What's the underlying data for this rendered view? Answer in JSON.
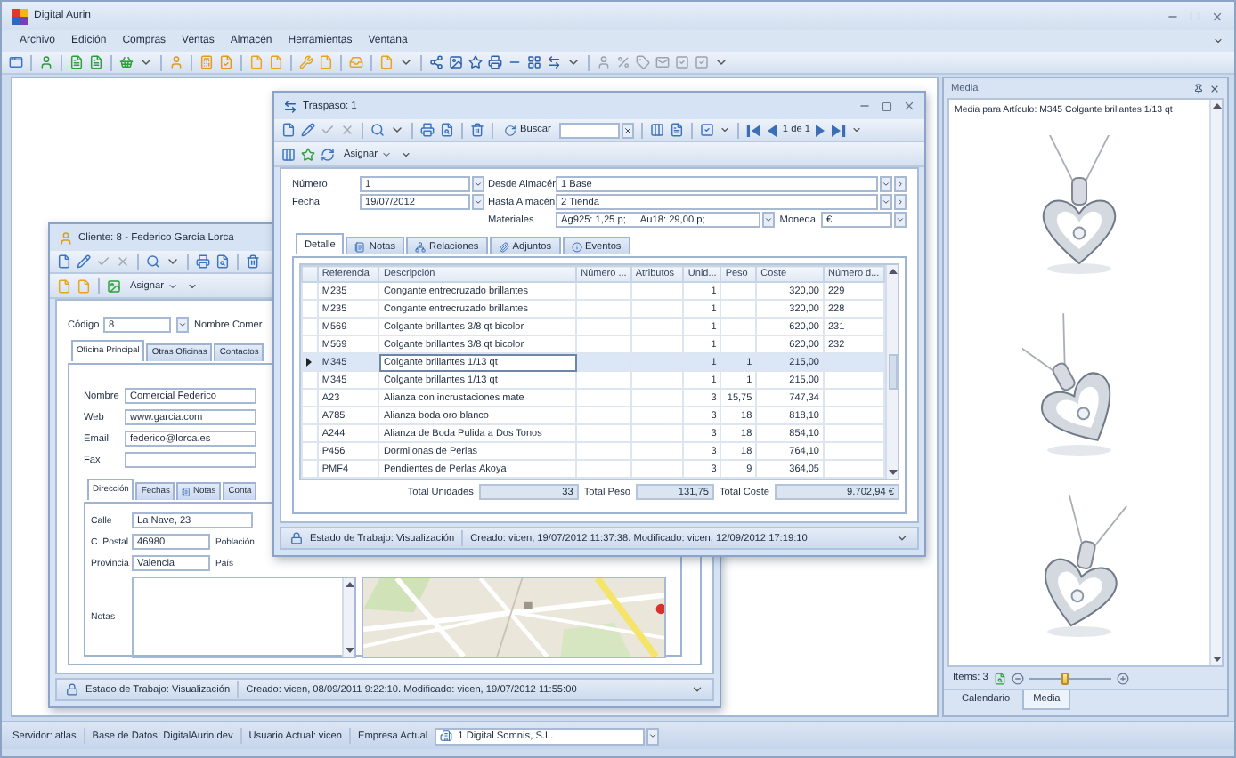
{
  "app": {
    "title": "Digital Aurin"
  },
  "menu": [
    "Archivo",
    "Edición",
    "Compras",
    "Ventas",
    "Almacén",
    "Herramientas",
    "Ventana"
  ],
  "traspaso": {
    "title": "Traspaso: 1",
    "search_label": "Buscar",
    "pager": "1 de 1",
    "assign": "Asignar",
    "numero": {
      "label": "Número",
      "value": "1"
    },
    "fecha": {
      "label": "Fecha",
      "value": "19/07/2012"
    },
    "desde": {
      "label": "Desde Almacén",
      "value": "1 Base"
    },
    "hasta": {
      "label": "Hasta Almacén",
      "value": "2 Tienda"
    },
    "materiales": {
      "label": "Materiales",
      "values": [
        "Ag925: 1,25 p;",
        "Au18: 29,00 p;"
      ]
    },
    "moneda": {
      "label": "Moneda",
      "value": "€"
    },
    "tabs": [
      {
        "label": "Detalle",
        "selected": true
      },
      {
        "label": "Notas",
        "selected": false
      },
      {
        "label": "Relaciones",
        "selected": false
      },
      {
        "label": "Adjuntos",
        "selected": false
      },
      {
        "label": "Eventos",
        "selected": false
      }
    ],
    "grid": {
      "columns": [
        "Referencia",
        "Descripción",
        "Número ...",
        "Atributos",
        "Unid...",
        "Peso",
        "Coste",
        "Número d..."
      ],
      "rows": [
        {
          "ref": "M235",
          "desc": "Congante entrecruzado brillantes",
          "units": "1",
          "cost": "320,00",
          "serial": "229",
          "selected": false
        },
        {
          "ref": "M235",
          "desc": "Congante entrecruzado brillantes",
          "units": "1",
          "cost": "320,00",
          "serial": "228",
          "selected": false
        },
        {
          "ref": "M569",
          "desc": "Colgante brillantes 3/8 qt bicolor",
          "units": "1",
          "cost": "620,00",
          "serial": "231",
          "selected": false
        },
        {
          "ref": "M569",
          "desc": "Colgante brillantes 3/8 qt bicolor",
          "units": "1",
          "cost": "620,00",
          "serial": "232",
          "selected": false
        },
        {
          "ref": "M345",
          "desc": "Colgante brillantes 1/13 qt",
          "units": "1",
          "weight": "1",
          "cost": "215,00",
          "selected": true
        },
        {
          "ref": "M345",
          "desc": "Colgante brillantes 1/13 qt",
          "units": "1",
          "weight": "1",
          "cost": "215,00",
          "selected": false
        },
        {
          "ref": "A23",
          "desc": "Alianza con incrustaciones mate",
          "units": "3",
          "weight": "15,75",
          "cost": "747,34",
          "selected": false
        },
        {
          "ref": "A785",
          "desc": "Alianza boda oro blanco",
          "units": "3",
          "weight": "18",
          "cost": "818,10",
          "selected": false
        },
        {
          "ref": "A244",
          "desc": "Alianza de Boda Pulida a Dos Tonos",
          "units": "3",
          "weight": "18",
          "cost": "854,10",
          "selected": false
        },
        {
          "ref": "P456",
          "desc": "Dormilonas de Perlas",
          "units": "3",
          "weight": "18",
          "cost": "764,10",
          "selected": false
        },
        {
          "ref": "PMF4",
          "desc": "Pendientes de Perlas Akoya",
          "units": "3",
          "weight": "9",
          "cost": "364,05",
          "selected": false
        }
      ]
    },
    "totals": [
      {
        "label": "Total Unidades",
        "value": "33"
      },
      {
        "label": "Total Peso",
        "value": "131,75"
      },
      {
        "label": "Total Coste",
        "value": "9.702,94 €"
      }
    ],
    "status": {
      "state": "Estado de Trabajo: Visualización",
      "info": "Creado: vicen, 19/07/2012 11:37:38. Modificado: vicen, 12/09/2012 17:19:10"
    }
  },
  "cliente": {
    "title": "Cliente: 8 - Federico García Lorca",
    "assign": "Asignar",
    "codigo": {
      "label": "Código",
      "value": "8"
    },
    "nombre_label": "Nombre Comer",
    "tabs": [
      {
        "label": "Oficina Principal",
        "selected": true
      },
      {
        "label": "Otras Oficinas",
        "selected": false
      },
      {
        "label": "Contactos",
        "selected": false
      }
    ],
    "contact": [
      {
        "label": "Nombre",
        "value": "Comercial Federico"
      },
      {
        "label": "Web",
        "value": "www.garcia.com"
      },
      {
        "label": "Email",
        "value": "federico@lorca.es"
      },
      {
        "label": "Fax"
      }
    ],
    "inner_tabs": [
      {
        "label": "Dirección",
        "selected": true
      },
      {
        "label": "Fechas",
        "selected": false
      },
      {
        "label": "Notas",
        "selected": false
      },
      {
        "label": "Conta",
        "selected": false
      }
    ],
    "calle": {
      "label": "Calle",
      "value": "La Nave, 23"
    },
    "postal": {
      "label": "C. Postal",
      "value": "46980"
    },
    "poblacion_label": "Población",
    "provincia": {
      "label": "Provincia",
      "value": "Valencia"
    },
    "pais_label": "País",
    "notas_label": "Notas",
    "status": {
      "state": "Estado de Trabajo: Visualización",
      "info": "Creado: vicen, 08/09/2011 9:22:10. Modificado: vicen, 19/07/2012 11:55:00"
    }
  },
  "media": {
    "title": "Media",
    "caption": "Media para Artículo: M345 Colgante brillantes 1/13 qt",
    "items": "Items: 3",
    "zoom": {
      "level": 0.43
    },
    "tabs": [
      {
        "label": "Calendario",
        "selected": false
      },
      {
        "label": "Media",
        "selected": true
      }
    ]
  },
  "status_bar": {
    "items": [
      "Servidor: atlas",
      "Base de Datos: DigitalAurin.dev",
      "Usuario Actual: vicen",
      "Empresa Actual"
    ],
    "company": "1 Digital Somnis, S.L."
  }
}
